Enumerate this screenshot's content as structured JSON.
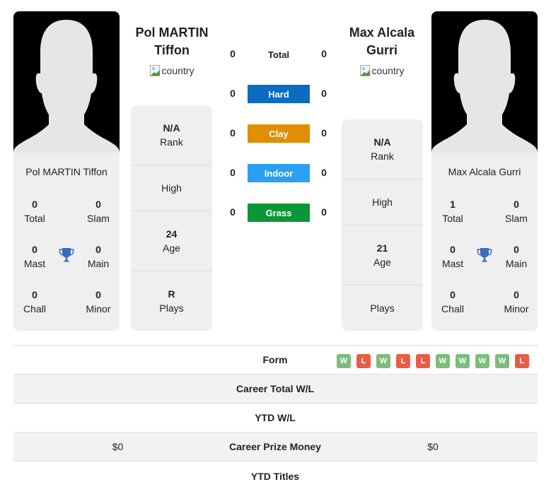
{
  "colors": {
    "hard": "#0a6cc1",
    "clay": "#df8f00",
    "indoor": "#2ba0f3",
    "grass": "#0b9638",
    "win": "#7dbd7b",
    "loss": "#ea5d43",
    "trophy": "#3a6bba"
  },
  "players": [
    {
      "name": "Pol MARTIN Tiffon",
      "country_alt": "country",
      "card_name": "Pol MARTIN Tiffon",
      "titles": {
        "total": {
          "value": "0",
          "label": "Total"
        },
        "slam": {
          "value": "0",
          "label": "Slam"
        },
        "mast": {
          "value": "0",
          "label": "Mast"
        },
        "main": {
          "value": "0",
          "label": "Main"
        },
        "chall": {
          "value": "0",
          "label": "Chall"
        },
        "minor": {
          "value": "0",
          "label": "Minor"
        }
      },
      "info": {
        "rank": {
          "value": "N/A",
          "label": "Rank"
        },
        "high": {
          "value": "",
          "label": "High"
        },
        "age": {
          "value": "24",
          "label": "Age"
        },
        "plays": {
          "value": "R",
          "label": "Plays"
        }
      }
    },
    {
      "name": "Max Alcala Gurri",
      "country_alt": "country",
      "card_name": "Max Alcala Gurri",
      "titles": {
        "total": {
          "value": "1",
          "label": "Total"
        },
        "slam": {
          "value": "0",
          "label": "Slam"
        },
        "mast": {
          "value": "0",
          "label": "Mast"
        },
        "main": {
          "value": "0",
          "label": "Main"
        },
        "chall": {
          "value": "0",
          "label": "Chall"
        },
        "minor": {
          "value": "0",
          "label": "Minor"
        }
      },
      "info": {
        "rank": {
          "value": "N/A",
          "label": "Rank"
        },
        "high": {
          "value": "",
          "label": "High"
        },
        "age": {
          "value": "21",
          "label": "Age"
        },
        "plays": {
          "value": "",
          "label": "Plays"
        }
      }
    }
  ],
  "surfaces": [
    {
      "label": "Total",
      "left": "0",
      "right": "0"
    },
    {
      "label": "Hard",
      "left": "0",
      "right": "0"
    },
    {
      "label": "Clay",
      "left": "0",
      "right": "0"
    },
    {
      "label": "Indoor",
      "left": "0",
      "right": "0"
    },
    {
      "label": "Grass",
      "left": "0",
      "right": "0"
    }
  ],
  "stats": {
    "form": {
      "label": "Form",
      "left": [],
      "right": [
        "W",
        "L",
        "W",
        "L",
        "L",
        "W",
        "W",
        "W",
        "W",
        "L"
      ]
    },
    "rows": [
      {
        "label": "Career Total W/L",
        "left": "",
        "right": ""
      },
      {
        "label": "YTD W/L",
        "left": "",
        "right": ""
      },
      {
        "label": "Career Prize Money",
        "left": "$0",
        "right": "$0"
      },
      {
        "label": "YTD Titles",
        "left": "",
        "right": ""
      }
    ]
  }
}
